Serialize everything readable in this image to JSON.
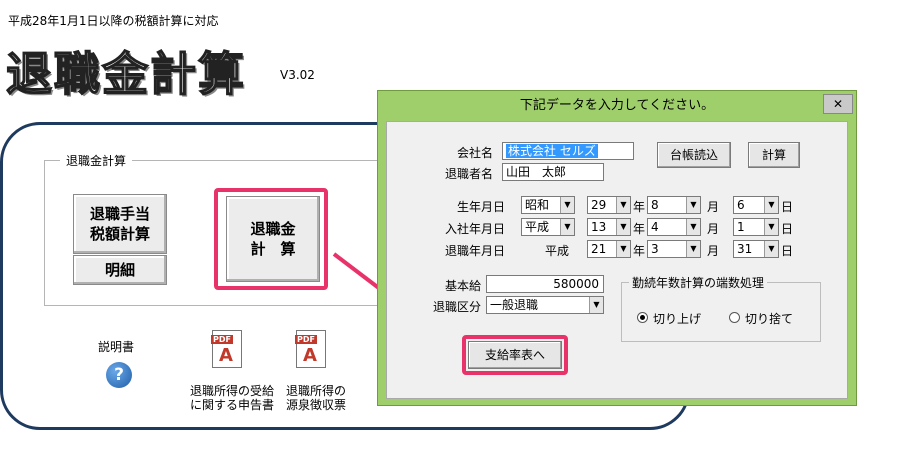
{
  "header": {
    "subtitle": "平成28年1月1日以降の税額計算に対応",
    "app_title": "退職金計算",
    "version": "V3.02"
  },
  "group": {
    "legend": "退職金計算"
  },
  "buttons": {
    "tax_calc": "退職手当\n税額計算",
    "detail": "明細",
    "retire_calc": "退職金\n計　算"
  },
  "docs": {
    "manual_label": "説明書",
    "pdf_tag": "PDF",
    "doc1": "退職所得の受給\nに関する申告書",
    "doc2": "退職所得の\n源泉徴収票"
  },
  "dialog": {
    "title": "下記データを入力してください。",
    "close": "✕",
    "labels": {
      "company": "会社名",
      "retiree": "退職者名",
      "birth": "生年月日",
      "hire": "入社年月日",
      "retire": "退職年月日",
      "salary": "基本給",
      "category": "退職区分",
      "year": "年",
      "month": "月",
      "day": "日"
    },
    "company_value": "株式会社 セルズ",
    "retiree_value": "山田　太郎",
    "btn_ledger": "台帳読込",
    "btn_calc": "計算",
    "birth": {
      "era": "昭和",
      "year": "29",
      "month": "8",
      "day": "6"
    },
    "hire": {
      "era": "平成",
      "year": "13",
      "month": "4",
      "day": "1"
    },
    "retire": {
      "era": "平成",
      "year": "21",
      "month": "3",
      "day": "31"
    },
    "salary_value": "580000",
    "category_value": "一般退職",
    "rounding": {
      "legend": "勤続年数計算の端数処理",
      "opt_up": "切り上げ",
      "opt_down": "切り捨て",
      "selected": "切り上げ"
    },
    "btn_next": "支給率表へ"
  },
  "colors": {
    "highlight": "#e8336a",
    "dialog_frame": "#9fcf6a",
    "panel_border": "#1f3a5f"
  }
}
